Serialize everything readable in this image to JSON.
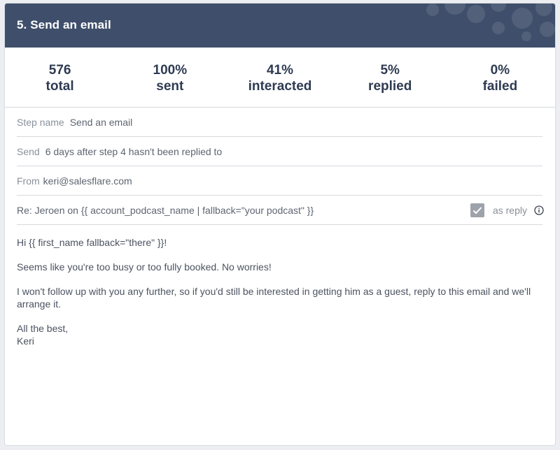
{
  "header": {
    "title": "5. Send an email"
  },
  "stats": [
    {
      "value": "576",
      "label": "total"
    },
    {
      "value": "100%",
      "label": "sent"
    },
    {
      "value": "41%",
      "label": "interacted"
    },
    {
      "value": "5%",
      "label": "replied"
    },
    {
      "value": "0%",
      "label": "failed"
    }
  ],
  "fields": {
    "step_name_label": "Step name",
    "step_name_value": "Send an email",
    "send_label": "Send",
    "send_value": "6 days after step 4 hasn't been replied to",
    "from_label": "From",
    "from_value": "keri@salesflare.com",
    "subject_value": "Re: Jeroen on {{ account_podcast_name | fallback=\"your podcast\" }}",
    "as_reply_label": "as reply",
    "as_reply_checked": true
  },
  "body": {
    "greeting": "Hi {{ first_name fallback=\"there\" }}!",
    "line1": "Seems like you're too busy or too fully booked. No worries!",
    "line2": "I won't follow up with you any further, so if you'd still be interested in getting him as a guest, reply to this email and we'll arrange it.",
    "closing": "All the best,",
    "signature": "Keri"
  },
  "colors": {
    "header_bg": "#3f4f6b",
    "stat_text": "#2f3b52",
    "checkbox": "#9ea3ab"
  },
  "icons": {
    "checkbox": "check-icon",
    "info": "info-icon"
  }
}
